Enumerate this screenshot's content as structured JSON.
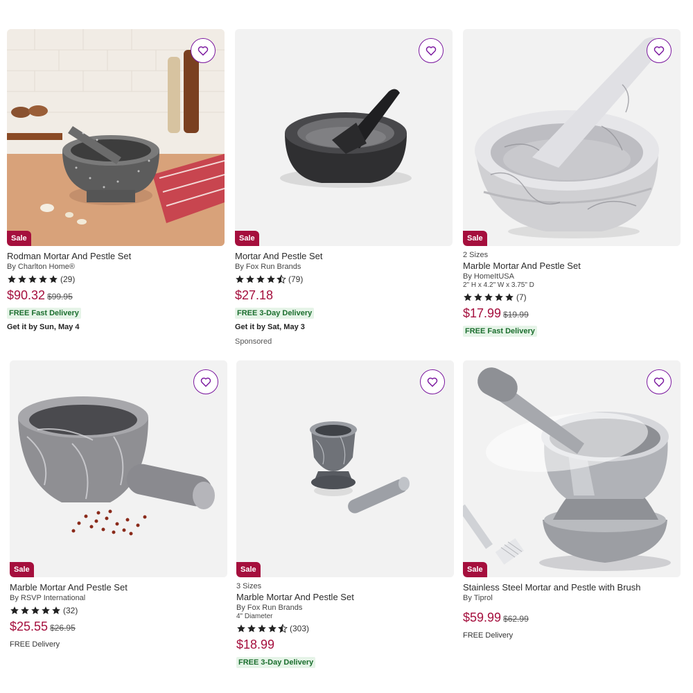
{
  "products": [
    {
      "sale": "Sale",
      "title": "Rodman Mortar And Pestle Set",
      "brand": "By Charlton Home®",
      "rating": 5,
      "count": "(29)",
      "price": "$90.32",
      "was": "$99.95",
      "delivery": "FREE Fast Delivery",
      "getit": "Get it by Sun, May 4"
    },
    {
      "sale": "Sale",
      "title": "Mortar And Pestle Set",
      "brand": "By Fox Run Brands",
      "rating": 4.5,
      "count": "(79)",
      "price": "$27.18",
      "delivery": "FREE 3-Day Delivery",
      "getit": "Get it by Sat, May 3",
      "sponsored": "Sponsored"
    },
    {
      "sale": "Sale",
      "sizes": "2 Sizes",
      "title": "Marble Mortar And Pestle Set",
      "brand": "By HomeItUSA",
      "dims": "2\" H x 4.2\" W x 3.75\" D",
      "rating": 5,
      "count": "(7)",
      "price": "$17.99",
      "was": "$19.99",
      "delivery": "FREE Fast Delivery"
    },
    {
      "sale": "Sale",
      "title": "Marble Mortar And Pestle Set",
      "brand": "By RSVP International",
      "rating": 5,
      "count": "(32)",
      "price": "$25.55",
      "was": "$26.95",
      "delivery_plain": "FREE Delivery"
    },
    {
      "sale": "Sale",
      "sizes": "3 Sizes",
      "title": "Marble Mortar And Pestle Set",
      "brand": "By Fox Run Brands",
      "dims": "4\" Diameter",
      "rating": 4.5,
      "count": "(303)",
      "price": "$18.99",
      "delivery": "FREE 3-Day Delivery"
    },
    {
      "sale": "Sale",
      "title": "Stainless Steel Mortar and Pestle with Brush",
      "brand": "By Tiprol",
      "price": "$59.99",
      "was": "$62.99",
      "delivery_plain": "FREE Delivery"
    }
  ],
  "icons": {
    "favorite": "heart-outline-icon",
    "star": "star-icon"
  },
  "colors": {
    "accent": "#7b189f",
    "sale": "#a50f3d",
    "delivery_bg": "#e6f4e8",
    "delivery_text": "#1b6e2e"
  }
}
